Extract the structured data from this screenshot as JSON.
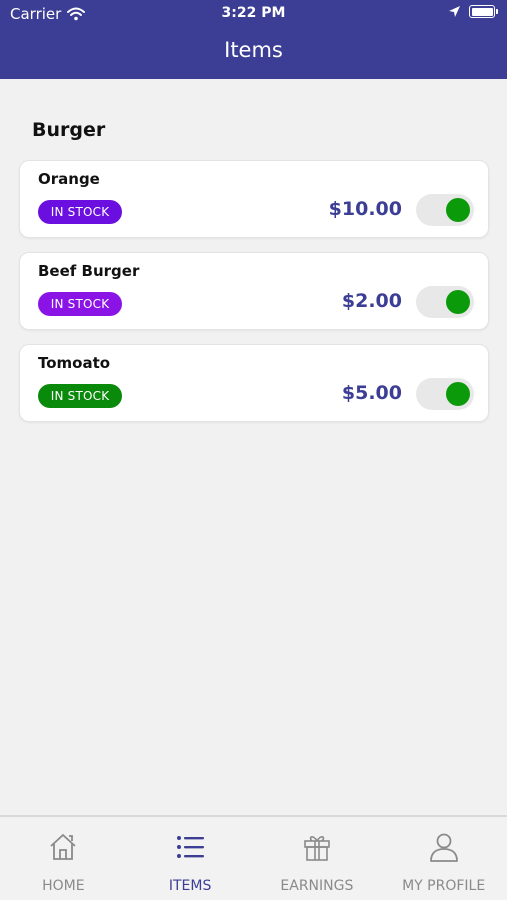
{
  "status_bar": {
    "carrier": "Carrier",
    "time": "3:22 PM"
  },
  "header": {
    "title": "Items"
  },
  "section": {
    "title": "Burger"
  },
  "items": [
    {
      "name": "Orange",
      "stock_label": "IN STOCK",
      "badge_color": "#6a0fe0",
      "price": "$10.00",
      "available": true
    },
    {
      "name": "Beef Burger",
      "stock_label": "IN STOCK",
      "badge_color": "#8a14e6",
      "price": "$2.00",
      "available": true
    },
    {
      "name": "Tomoato",
      "stock_label": "IN STOCK",
      "badge_color": "#0a8a0a",
      "price": "$5.00",
      "available": true
    }
  ],
  "tabs": [
    {
      "label": "HOME",
      "icon": "home-icon",
      "active": false
    },
    {
      "label": "ITEMS",
      "icon": "list-icon",
      "active": true
    },
    {
      "label": "EARNINGS",
      "icon": "gift-icon",
      "active": false
    },
    {
      "label": "MY PROFILE",
      "icon": "user-icon",
      "active": false
    }
  ],
  "colors": {
    "primary": "#3b3e94",
    "toggle_on": "#0a9a0a",
    "background": "#f1f1f1"
  }
}
